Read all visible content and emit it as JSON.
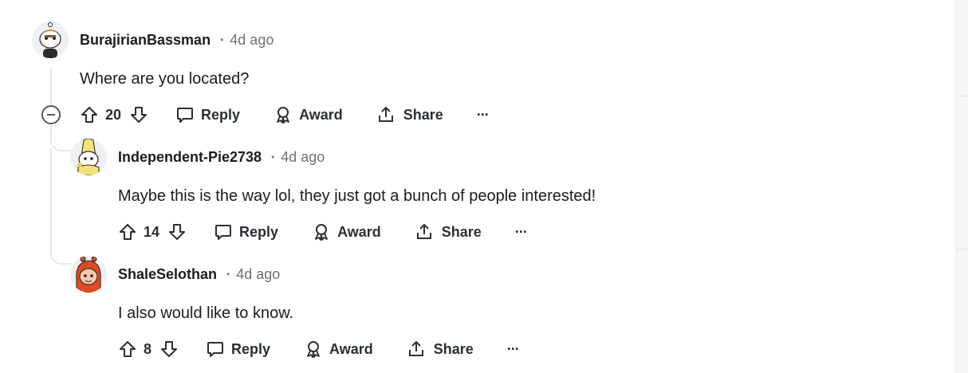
{
  "comments": [
    {
      "author": "BurajirianBassman",
      "separator": "•",
      "time": "4d ago",
      "text": "Where are you located?",
      "votes": "20",
      "reply_label": "Reply",
      "award_label": "Award",
      "share_label": "Share",
      "more_label": "···",
      "avatar_icon": "snoo-avatar-with-beard",
      "collapse_icon": "collapse-minus-icon"
    },
    {
      "author": "Independent-Pie2738",
      "separator": "•",
      "time": "4d ago",
      "text": "Maybe this is the way lol, they just got a bunch of people interested!",
      "votes": "14",
      "reply_label": "Reply",
      "award_label": "Award",
      "share_label": "Share",
      "more_label": "···",
      "avatar_icon": "snoo-avatar-banana-costume"
    },
    {
      "author": "ShaleSelothan",
      "separator": "•",
      "time": "4d ago",
      "text": "I also would like to know.",
      "votes": "8",
      "reply_label": "Reply",
      "award_label": "Award",
      "share_label": "Share",
      "more_label": "···",
      "avatar_icon": "snoo-avatar-red-hood"
    }
  ],
  "colors": {
    "text": "#1c1c1c",
    "meta": "#6a7178",
    "action": "#2a3036",
    "thread_line": "#e6e8eb"
  }
}
